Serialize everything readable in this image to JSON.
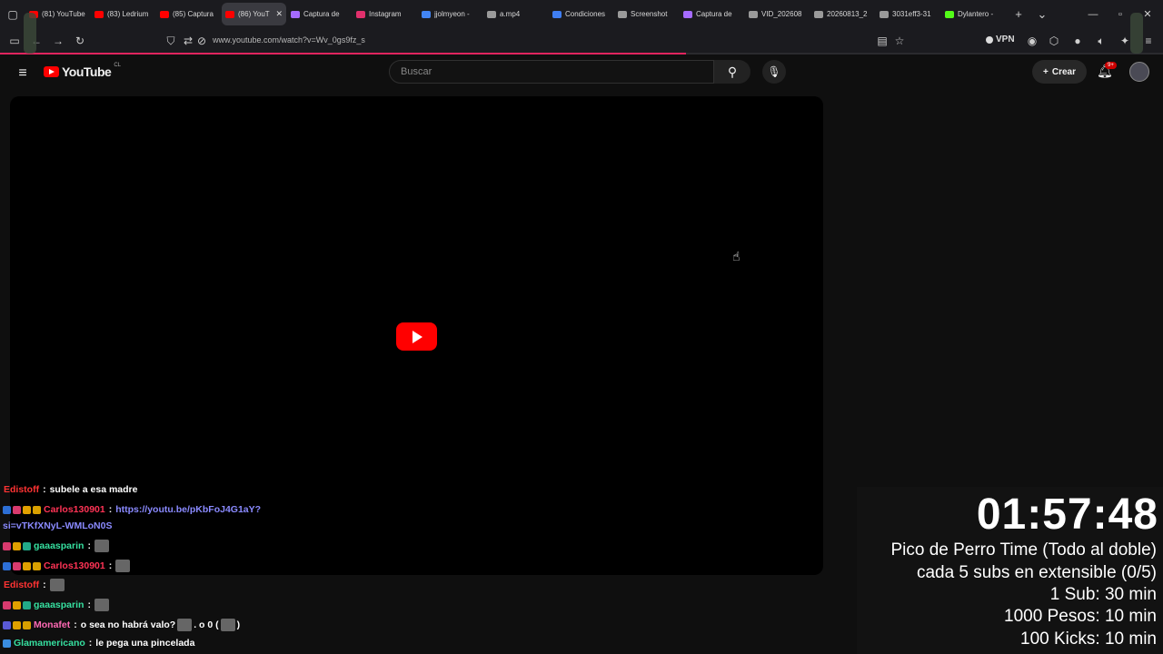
{
  "browser": {
    "tabs": [
      {
        "label": "(81) YouTube",
        "color": "#ff0000"
      },
      {
        "label": "(83) Ledrium",
        "color": "#ff0000"
      },
      {
        "label": "(85) Captura",
        "color": "#ff0000"
      },
      {
        "label": "(86) YouT",
        "color": "#ff0000",
        "active": true
      },
      {
        "label": "Captura de",
        "color": "#a56bff"
      },
      {
        "label": "Instagram",
        "color": "#e1306c"
      },
      {
        "label": "jjolmyeon -",
        "color": "#4285f4"
      },
      {
        "label": "a.mp4",
        "color": "#9a9a9a"
      },
      {
        "label": "Condiciones",
        "color": "#3f7ef2"
      },
      {
        "label": "Screenshot",
        "color": "#9a9a9a"
      },
      {
        "label": "Captura de",
        "color": "#a56bff"
      },
      {
        "label": "VID_202608",
        "color": "#9a9a9a"
      },
      {
        "label": "20260813_2",
        "color": "#9a9a9a"
      },
      {
        "label": "3031eff3-31",
        "color": "#9a9a9a"
      },
      {
        "label": "Dylantero -",
        "color": "#53fc18"
      }
    ],
    "url": "www.youtube.com/watch?v=Wv_0gs9fz_s",
    "vpn_label": "VPN",
    "page_load_progress": 0.59
  },
  "youtube": {
    "logo_text": "YouTube",
    "country_code": "CL",
    "search_placeholder": "Buscar",
    "create_label": "Crear",
    "notifications_badge": "9+"
  },
  "chat": [
    {
      "user": "Edistoff",
      "color": "#ff3333",
      "badges": [],
      "parts": [
        {
          "t": "msg",
          "v": "subele a esa madre"
        }
      ]
    },
    {
      "user": "Carlos130901",
      "color": "#ff3355",
      "badges": [
        "#2d6fd6",
        "#d83a6e",
        "#e0a000",
        "#d8a000"
      ],
      "parts": [
        {
          "t": "link",
          "v": "https://youtu.be/pKbFoJ4G1aY?"
        }
      ],
      "continuation": "si=vTKfXNyL-WMLoN0S"
    },
    {
      "user": "gaaasparin",
      "color": "#36e0a0",
      "badges": [
        "#d83a6e",
        "#e0a000",
        "#22aa88"
      ],
      "parts": [
        {
          "t": "emote"
        }
      ]
    },
    {
      "user": "Carlos130901",
      "color": "#ff3355",
      "badges": [
        "#2d6fd6",
        "#d83a6e",
        "#e0a000",
        "#d8a000"
      ],
      "parts": [
        {
          "t": "emote"
        }
      ]
    },
    {
      "user": "Edistoff",
      "color": "#ff3333",
      "badges": [],
      "parts": [
        {
          "t": "emote"
        }
      ]
    },
    {
      "user": "gaaasparin",
      "color": "#36e0a0",
      "badges": [
        "#d83a6e",
        "#e0a000",
        "#22aa88"
      ],
      "parts": [
        {
          "t": "emote"
        }
      ]
    },
    {
      "user": "Monafet",
      "color": "#ff69b4",
      "badges": [
        "#5a5ad6",
        "#e0a000",
        "#d8a000"
      ],
      "parts": [
        {
          "t": "msg",
          "v": "o sea no habrá valo?"
        },
        {
          "t": "emote"
        },
        {
          "t": "msg",
          "v": ". o 0 ("
        },
        {
          "t": "emote"
        },
        {
          "t": "msg",
          "v": ")"
        }
      ]
    },
    {
      "user": "Glamamericano",
      "color": "#36e0a0",
      "badges": [
        "#3a8de0"
      ],
      "parts": [
        {
          "t": "msg",
          "v": "le pega una pincelada"
        }
      ]
    }
  ],
  "timer": {
    "time": "01:57:48",
    "rules": [
      "Pico de Perro Time (Todo al doble)",
      "cada 5 subs en extensible (0/5)",
      "1 Sub: 30 min",
      "1000 Pesos: 10 min",
      "100 Kicks: 10 min"
    ]
  }
}
